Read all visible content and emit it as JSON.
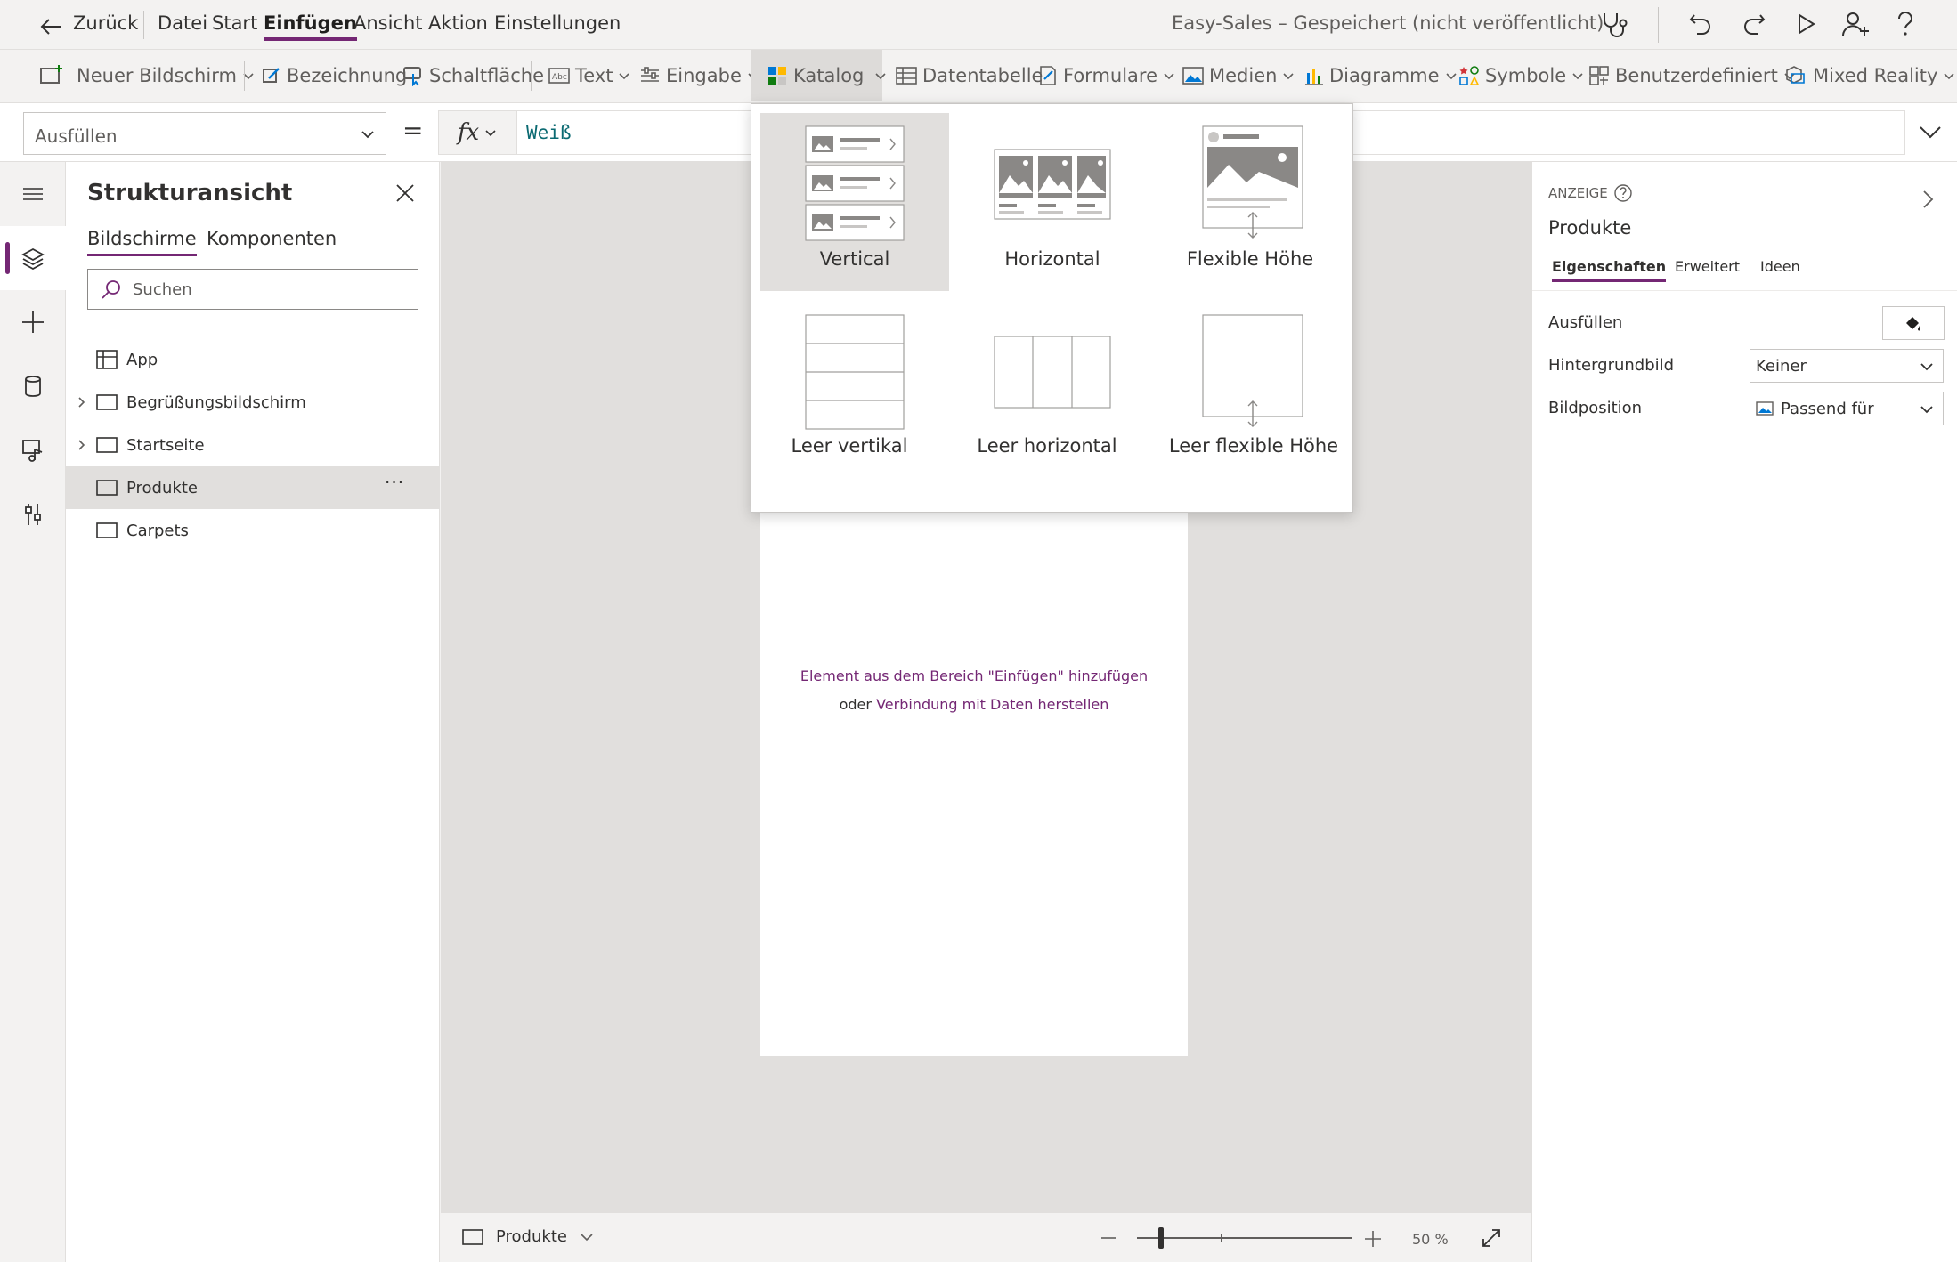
{
  "menubar": {
    "back_label": "Zurück",
    "items": [
      "Datei",
      "Start",
      "Einfügen",
      "Ansicht",
      "Aktion",
      "Einstellungen"
    ],
    "active": "Einfügen",
    "app_title": "Easy-Sales – Gespeichert (nicht veröffentlicht)",
    "icons": [
      "stethoscope-icon",
      "undo-icon",
      "redo-icon",
      "play-icon",
      "share-user-icon",
      "help-icon"
    ]
  },
  "ribbon": {
    "items": [
      {
        "label": "Neuer Bildschirm",
        "icon": "new-screen-icon",
        "dropdown": true
      },
      {
        "label": "Bezeichnung",
        "icon": "label-icon",
        "dropdown": false
      },
      {
        "label": "Schaltfläche",
        "icon": "button-icon",
        "dropdown": false
      },
      {
        "label": "Text",
        "icon": "text-icon",
        "dropdown": true
      },
      {
        "label": "Eingabe",
        "icon": "input-icon",
        "dropdown": true
      },
      {
        "label": "Katalog",
        "icon": "gallery-icon",
        "dropdown": true,
        "active": true
      },
      {
        "label": "Datentabelle",
        "icon": "data-table-icon",
        "dropdown": false
      },
      {
        "label": "Formulare",
        "icon": "forms-icon",
        "dropdown": true
      },
      {
        "label": "Medien",
        "icon": "media-icon",
        "dropdown": true
      },
      {
        "label": "Diagramme",
        "icon": "charts-icon",
        "dropdown": true
      },
      {
        "label": "Symbole",
        "icon": "icons-icon",
        "dropdown": true
      },
      {
        "label": "Benutzerdefiniert",
        "icon": "custom-icon",
        "dropdown": true
      },
      {
        "label": "Mixed Reality",
        "icon": "mixed-reality-icon",
        "dropdown": true
      }
    ]
  },
  "formula": {
    "property": "Ausfüllen",
    "equals": "=",
    "fx": "fx",
    "value": "Weiß"
  },
  "tree": {
    "title": "Strukturansicht",
    "tabs": [
      "Bildschirme",
      "Komponenten"
    ],
    "search_placeholder": "Suchen",
    "rows": [
      {
        "label": "App",
        "expandable": false
      },
      {
        "label": "Begrüßungsbildschirm",
        "expandable": true
      },
      {
        "label": "Startseite",
        "expandable": true
      },
      {
        "label": "Produkte",
        "expandable": false,
        "selected": true
      },
      {
        "label": "Carpets",
        "expandable": false
      }
    ],
    "more": "···"
  },
  "canvas": {
    "hint_link1": "Element aus dem Bereich \"Einfügen\" hinzufügen",
    "hint_or": "oder",
    "hint_link2": "Verbindung mit Daten herstellen"
  },
  "statusbar": {
    "screen": "Produkte",
    "zoom": "50 %",
    "zoom_level": 50
  },
  "props": {
    "header": "ANZEIGE",
    "name": "Produkte",
    "tabs": [
      "Eigenschaften",
      "Erweitert",
      "Ideen"
    ],
    "fill_label": "Ausfüllen",
    "bg_label": "Hintergrundbild",
    "bg_value": "Keiner",
    "pos_label": "Bildposition",
    "pos_value": "Passend für"
  },
  "gallery_menu": {
    "options": [
      "Vertical",
      "Horizontal",
      "Flexible Höhe",
      "Leer vertikal",
      "Leer horizontal",
      "Leer flexible Höhe"
    ],
    "selected": "Vertical"
  },
  "colors": {
    "accent": "#742774",
    "formula_text": "#0b6a72",
    "canvas": "#e1dfdd"
  }
}
